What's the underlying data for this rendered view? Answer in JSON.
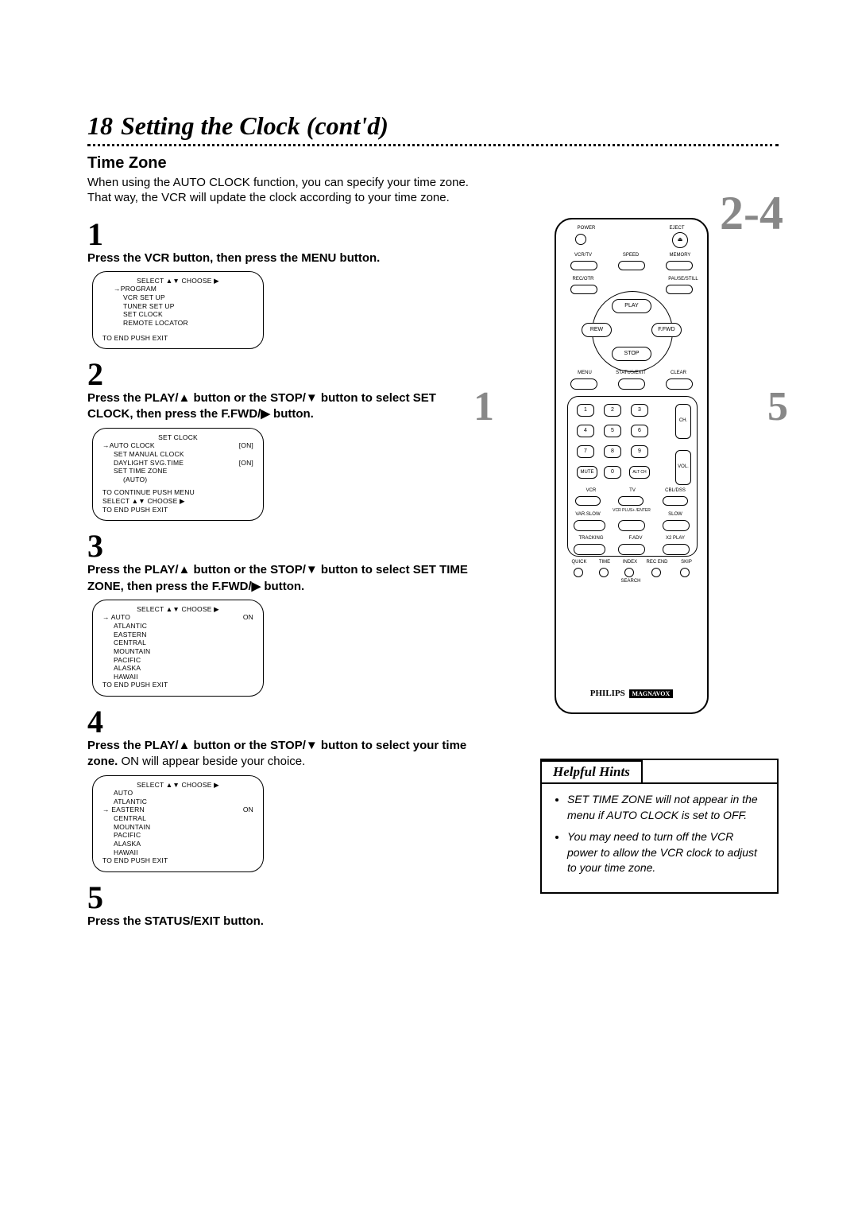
{
  "page_number": "18",
  "page_title": "Setting the Clock (cont'd)",
  "section_heading": "Time Zone",
  "intro": "When using the AUTO CLOCK function, you can specify your time zone. That way, the VCR will update the clock according to your time zone.",
  "step_range": "2-4",
  "side_left_callout": "1",
  "side_right_callout": "5",
  "steps": {
    "s1": {
      "num": "1",
      "text": "Press the VCR button, then press the MENU button."
    },
    "s2": {
      "num": "2",
      "text_a": "Press the PLAY/▲ button or the STOP/▼ button to select SET CLOCK, then press the F.FWD/▶ button."
    },
    "s3": {
      "num": "3",
      "text_a": "Press the PLAY/▲ button or the STOP/▼ button to select SET TIME ZONE, then press the F.FWD/▶ button."
    },
    "s4": {
      "num": "4",
      "text_a": "Press the PLAY/▲ button or the STOP/▼ button to select your time zone.",
      "text_b": " ON will appear beside your choice."
    },
    "s5": {
      "num": "5",
      "text_a": "Press the STATUS/EXIT button."
    }
  },
  "osd1": {
    "header": "SELECT ▲▼ CHOOSE ▶",
    "lines": [
      "→PROGRAM",
      "VCR SET UP",
      "TUNER SET UP",
      "SET CLOCK",
      "REMOTE LOCATOR"
    ],
    "footer": "TO END PUSH EXIT"
  },
  "osd2": {
    "title": "SET CLOCK",
    "rows": [
      {
        "l": "→AUTO CLOCK",
        "r": "[ON]"
      },
      {
        "l": "SET MANUAL CLOCK",
        "r": ""
      },
      {
        "l": "DAYLIGHT SVG.TIME",
        "r": "[ON]"
      },
      {
        "l": "SET TIME ZONE",
        "r": ""
      },
      {
        "l": "(AUTO)",
        "r": ""
      }
    ],
    "footer": [
      "TO CONTINUE PUSH MENU",
      "SELECT ▲▼ CHOOSE ▶",
      "TO END PUSH EXIT"
    ]
  },
  "osd3": {
    "header": "SELECT ▲▼ CHOOSE ▶",
    "rows": [
      {
        "l": "→ AUTO",
        "r": "ON"
      },
      {
        "l": "ATLANTIC",
        "r": ""
      },
      {
        "l": "EASTERN",
        "r": ""
      },
      {
        "l": "CENTRAL",
        "r": ""
      },
      {
        "l": "MOUNTAIN",
        "r": ""
      },
      {
        "l": "PACIFIC",
        "r": ""
      },
      {
        "l": "ALASKA",
        "r": ""
      },
      {
        "l": "HAWAII",
        "r": ""
      }
    ],
    "footer": "TO END PUSH EXIT"
  },
  "osd4": {
    "header": "SELECT ▲▼ CHOOSE ▶",
    "rows": [
      {
        "l": "AUTO",
        "r": ""
      },
      {
        "l": "ATLANTIC",
        "r": ""
      },
      {
        "l": "→ EASTERN",
        "r": "ON"
      },
      {
        "l": "CENTRAL",
        "r": ""
      },
      {
        "l": "MOUNTAIN",
        "r": ""
      },
      {
        "l": "PACIFIC",
        "r": ""
      },
      {
        "l": "ALASKA",
        "r": ""
      },
      {
        "l": "HAWAII",
        "r": ""
      }
    ],
    "footer": "TO END PUSH EXIT"
  },
  "remote": {
    "labels": {
      "power": "POWER",
      "eject": "EJECT",
      "vcrtv": "VCR/TV",
      "speed": "SPEED",
      "memory": "MEMORY",
      "recotr": "REC/OTR",
      "pausestill": "PAUSE/STILL",
      "play": "PLAY",
      "rew": "REW",
      "ffwd": "F.FWD",
      "stop": "STOP",
      "menu": "MENU",
      "statusexit": "STATUS/EXIT",
      "clear": "CLEAR",
      "mute": "MUTE",
      "altch": "ALT CH",
      "ch": "CH.",
      "vol": "VOL.",
      "vcr": "VCR",
      "tv": "TV",
      "cbldss": "CBL/DSS",
      "varslow": "VAR.SLOW",
      "vcrplus": "VCR PLUS+ /ENTER",
      "slow": "SLOW",
      "tracking": "TRACKING",
      "fadv": "F.ADV",
      "x2": "X2 PLAY",
      "quick": "QUICK",
      "time": "TIME",
      "index": "INDEX",
      "recend": "REC END",
      "skip": "SKIP",
      "search": "SEARCH",
      "n0": "0",
      "n1": "1",
      "n2": "2",
      "n3": "3",
      "n4": "4",
      "n5": "5",
      "n6": "6",
      "n7": "7",
      "n8": "8",
      "n9": "9"
    },
    "brand": "PHILIPS",
    "brand2": "MAGNAVOX"
  },
  "hints": {
    "title": "Helpful Hints",
    "items": [
      "SET TIME ZONE will not appear in the menu if AUTO CLOCK is set to OFF.",
      "You may need to turn off the VCR power to allow the VCR clock to adjust to your time zone."
    ]
  }
}
